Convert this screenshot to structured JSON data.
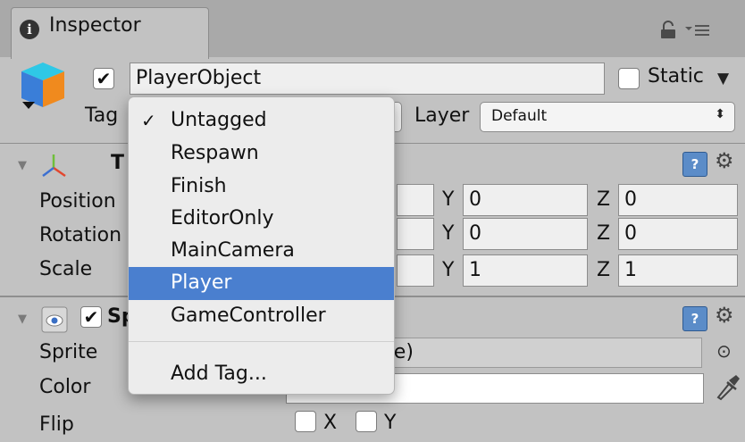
{
  "tab": {
    "title": "Inspector"
  },
  "game_object": {
    "name": "PlayerObject",
    "active": true,
    "static_label": "Static",
    "tag_label": "Tag",
    "layer_label": "Layer",
    "layer_value": "Default"
  },
  "transform": {
    "title": "T",
    "rows": {
      "position": {
        "label": "Position",
        "y": "0",
        "z": "0"
      },
      "rotation": {
        "label": "Rotation",
        "y": "0",
        "z": "0"
      },
      "scale": {
        "label": "Scale",
        "y": "1",
        "z": "1"
      }
    },
    "axis_y": "Y",
    "axis_z": "Z"
  },
  "sprite_renderer": {
    "title_partial": "Sp",
    "sprite_label": "Sprite",
    "sprite_value_partial": "rite)",
    "color_label": "Color",
    "color_value": "#ffffff",
    "flip_label": "Flip",
    "flip_x": "X",
    "flip_y": "Y"
  },
  "tag_menu": {
    "items": [
      {
        "label": "Untagged",
        "checked": true
      },
      {
        "label": "Respawn"
      },
      {
        "label": "Finish"
      },
      {
        "label": "EditorOnly"
      },
      {
        "label": "MainCamera"
      },
      {
        "label": "Player",
        "highlighted": true
      },
      {
        "label": "GameController"
      }
    ],
    "add_label": "Add Tag...",
    "check_glyph": "✓"
  },
  "colors": {
    "highlight": "#4a7fcf",
    "panel": "#c2c2c2",
    "tabbar": "#a9a9a9",
    "help_icon": "#5b8cc8"
  }
}
